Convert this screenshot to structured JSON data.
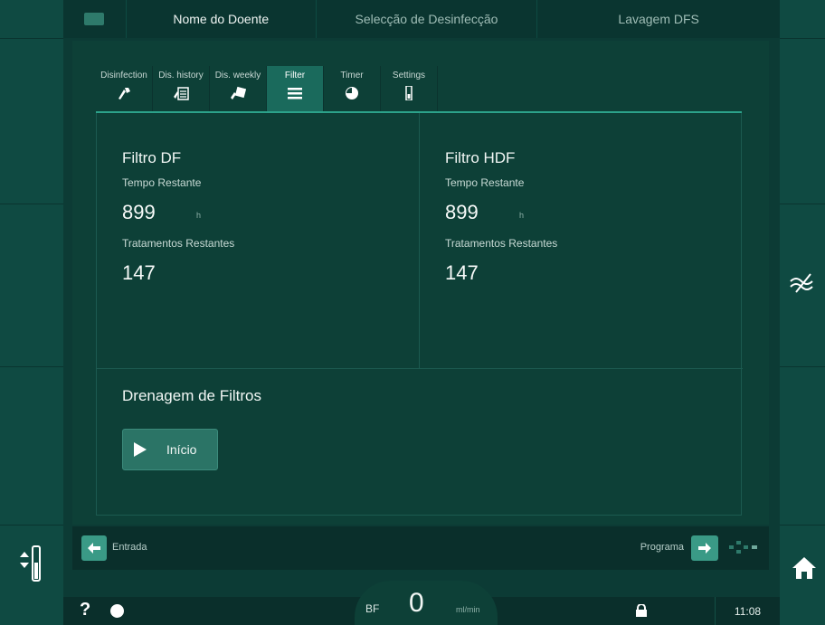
{
  "header": {
    "tabs": [
      "Nome do Doente",
      "Selecção de Desinfecção",
      "Lavagem DFS"
    ]
  },
  "subtabs": [
    {
      "label": "Disinfection",
      "icon": "disinfection-icon"
    },
    {
      "label": "Dis. history",
      "icon": "history-icon"
    },
    {
      "label": "Dis. weekly",
      "icon": "weekly-icon"
    },
    {
      "label": "Filter",
      "icon": "filter-list-icon",
      "active": true
    },
    {
      "label": "Timer",
      "icon": "timer-icon"
    },
    {
      "label": "Settings",
      "icon": "settings-icon"
    }
  ],
  "filters": {
    "df": {
      "title": "Filtro DF",
      "time_label": "Tempo Restante",
      "time_value": "899",
      "time_unit": "h",
      "treatments_label": "Tratamentos Restantes",
      "treatments_value": "147"
    },
    "hdf": {
      "title": "Filtro HDF",
      "time_label": "Tempo Restante",
      "time_value": "899",
      "time_unit": "h",
      "treatments_label": "Tratamentos Restantes",
      "treatments_value": "147"
    }
  },
  "drain": {
    "title": "Drenagem de Filtros",
    "start_label": "Início"
  },
  "nav": {
    "back_label": "Entrada",
    "next_label": "Programa"
  },
  "status": {
    "help": "?",
    "bf_label": "BF",
    "bf_value": "0",
    "bf_unit": "ml/min",
    "time": "11:08"
  },
  "colors": {
    "background": "#0c3b35",
    "accent": "#2ca28a",
    "active_tab": "#1a6a5c",
    "button": "#3a9a86"
  }
}
